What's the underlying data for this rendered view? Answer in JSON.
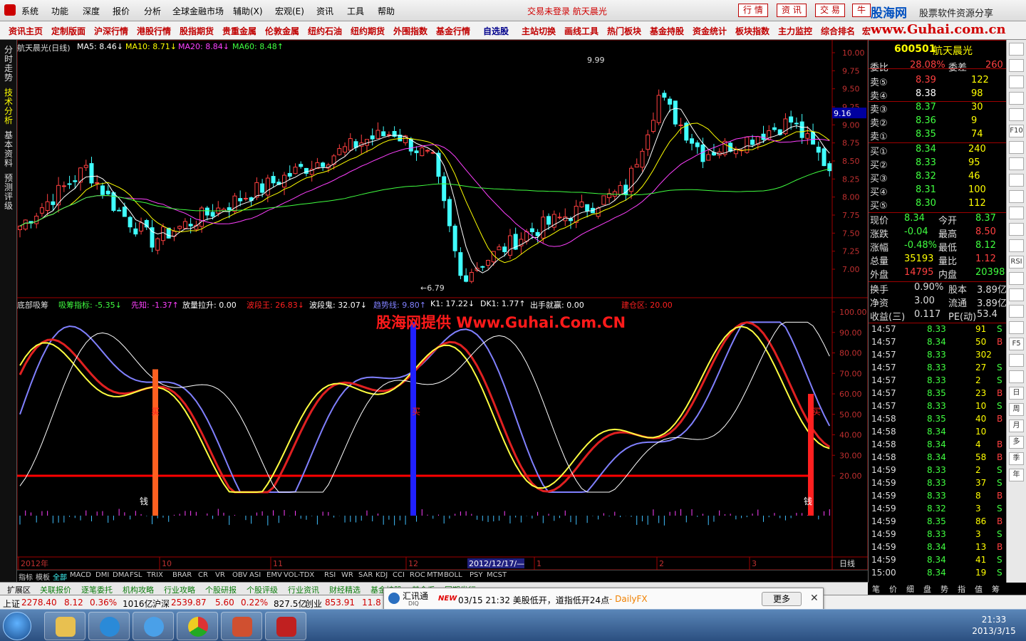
{
  "menu": {
    "items": [
      "系统",
      "功能",
      "深度",
      "报价",
      "分析",
      "全球金融市场",
      "辅助(X)",
      "宏观(E)",
      "资讯",
      "工具",
      "帮助"
    ],
    "notice": "交易未登录  航天晨光",
    "buttons": [
      "行 情",
      "资 讯",
      "交 易",
      "牛"
    ],
    "brand": "股海网",
    "brand_sub": "股票软件资源分享"
  },
  "nav": {
    "items": [
      "资讯主页",
      "定制版面",
      "沪深行情",
      "港股行情",
      "股指期货",
      "贵重金属",
      "伦敦金属",
      "纽约石油",
      "纽约期货",
      "外围指数",
      "基金行情",
      "自选股",
      "主站切换",
      "画线工具",
      "热门板块",
      "基金持股",
      "资金统计",
      "板块指数",
      "主力监控",
      "综合排名",
      "宏"
    ],
    "site": "www.Guhai.com.cn"
  },
  "left_tabs": [
    "分时走势",
    "技术分析",
    "基本资料",
    "预测评级"
  ],
  "chart": {
    "title": "航天晨光(日线)",
    "ma": [
      {
        "label": "MA5: 8.46↓",
        "color": "#ffffff"
      },
      {
        "label": "MA10: 8.71↓",
        "color": "#ffff00"
      },
      {
        "label": "MA20: 8.84↓",
        "color": "#ff40ff"
      },
      {
        "label": "MA60: 8.48↑",
        "color": "#40ff40"
      }
    ],
    "price_axis": [
      "10.00",
      "9.75",
      "9.50",
      "9.25",
      "9.00",
      "8.75",
      "8.50",
      "8.25",
      "8.00",
      "7.75",
      "7.50",
      "7.25",
      "7.00"
    ],
    "current_price_tag": "9.16",
    "high_label": "9.99",
    "low_label": "6.79",
    "indicator_title": "底部吸筹",
    "indicators": [
      {
        "label": "吸筹指标: -5.35↓",
        "color": "#40ff40"
      },
      {
        "label": "先知: -1.37↑",
        "color": "#ff40ff"
      },
      {
        "label": "放量拉升: 0.00",
        "color": "#ffffff"
      },
      {
        "label": "波段王: 26.83↓",
        "color": "#ff2020"
      },
      {
        "label": "波段鬼: 32.07↓",
        "color": "#ffffff"
      },
      {
        "label": "趋势线: 9.80↑",
        "color": "#8080ff"
      },
      {
        "label": "K1: 17.22↓",
        "color": "#ffffff"
      },
      {
        "label": "DK1: 1.77↑",
        "color": "#ffffff"
      },
      {
        "label": "出手就赢: 0.00",
        "color": "#ffffff"
      },
      {
        "label": "建仓区: 20.00",
        "color": "#ff2020"
      }
    ],
    "ind_axis": [
      "100.00",
      "90.00",
      "80.00",
      "70.00",
      "60.00",
      "50.00",
      "40.00",
      "30.00",
      "20.00"
    ],
    "watermark": "股海网提供 Www.Guhai.Com.CN",
    "buy_label": "买",
    "money_label": "钱",
    "date_axis": [
      "2012年",
      "10",
      "11",
      "12",
      "1",
      "2",
      "3"
    ],
    "date_cursor": "2012/12/17/—",
    "period": "日线",
    "bottom_tabs": [
      "指标",
      "模板",
      "全部",
      "MACD",
      "DMI",
      "DMA",
      "FSL",
      "TRIX",
      "BRAR",
      "CR",
      "VR",
      "OBV",
      "ASI",
      "EMV",
      "VOL-TDX",
      "RSI",
      "WR",
      "SAR",
      "KDJ",
      "CCI",
      "ROC",
      "MTM",
      "BOLL",
      "PSY",
      "MCST"
    ]
  },
  "ext_bar": [
    "扩展区",
    "关联报价",
    "逐笔委托",
    "机构攻略",
    "行业攻略",
    "个股研报",
    "个股评级",
    "行业资讯",
    "财经精选",
    "基金持股",
    "基金系",
    "同期发行"
  ],
  "status_bar": {
    "sh_label": "上证",
    "sh_index": "2278.40",
    "sh_change": "8.12",
    "sh_pct": "0.36%",
    "sh_amount": "1016亿",
    "sz_label": "沪深",
    "sz_index": "2539.87",
    "sz_change": "5.60",
    "sz_pct": "0.22%",
    "sz_amount": "827.5亿",
    "cy_label": "创业",
    "cy_index": "853.91",
    "cy_change": "11.8"
  },
  "news": {
    "app": "汇讯通",
    "app_sub": "DIQ",
    "tag": "NEW",
    "text": "03/15 21:32 美股低开，道指低开24点",
    "source": "- DailyFX",
    "more": "更多",
    "close": "✕"
  },
  "quote": {
    "code": "600501",
    "name": "航天晨光",
    "webi_label": "委比",
    "webi": "28.08%",
    "weicha_label": "委差",
    "weicha": "260",
    "sell": [
      {
        "label": "卖⑤",
        "price": "8.39",
        "vol": "122"
      },
      {
        "label": "卖④",
        "price": "8.38",
        "vol": "98"
      },
      {
        "label": "卖③",
        "price": "8.37",
        "vol": "30"
      },
      {
        "label": "卖②",
        "price": "8.36",
        "vol": "9"
      },
      {
        "label": "卖①",
        "price": "8.35",
        "vol": "74"
      }
    ],
    "buy": [
      {
        "label": "买①",
        "price": "8.34",
        "vol": "240"
      },
      {
        "label": "买②",
        "price": "8.33",
        "vol": "95"
      },
      {
        "label": "买③",
        "price": "8.32",
        "vol": "46"
      },
      {
        "label": "买④",
        "price": "8.31",
        "vol": "100"
      },
      {
        "label": "买⑤",
        "price": "8.30",
        "vol": "112"
      }
    ],
    "stats": [
      {
        "l1": "现价",
        "v1": "8.34",
        "c1": "#40ff40",
        "l2": "今开",
        "v2": "8.37",
        "c2": "#40ff40"
      },
      {
        "l1": "涨跌",
        "v1": "-0.04",
        "c1": "#40ff40",
        "l2": "最高",
        "v2": "8.50",
        "c2": "#ff4040"
      },
      {
        "l1": "涨幅",
        "v1": "-0.48%",
        "c1": "#40ff40",
        "l2": "最低",
        "v2": "8.12",
        "c2": "#40ff40"
      },
      {
        "l1": "总量",
        "v1": "35193",
        "c1": "#ffff00",
        "l2": "量比",
        "v2": "1.12",
        "c2": "#ff4040"
      },
      {
        "l1": "外盘",
        "v1": "14795",
        "c1": "#ff4040",
        "l2": "内盘",
        "v2": "20398",
        "c2": "#40ff40"
      }
    ],
    "fund": [
      {
        "l1": "换手",
        "v1": "0.90%",
        "l2": "股本",
        "v2": "3.89亿"
      },
      {
        "l1": "净资",
        "v1": "3.00",
        "l2": "流通",
        "v2": "3.89亿"
      },
      {
        "l1": "收益(三)",
        "v1": "0.117",
        "l2": "PE(动)",
        "v2": "53.4"
      }
    ]
  },
  "ticks": [
    {
      "t": "14:57",
      "p": "8.33",
      "v": "91",
      "s": "S"
    },
    {
      "t": "14:57",
      "p": "8.34",
      "v": "50",
      "s": "B"
    },
    {
      "t": "14:57",
      "p": "8.33",
      "v": "302",
      "s": ""
    },
    {
      "t": "14:57",
      "p": "8.33",
      "v": "27",
      "s": "S"
    },
    {
      "t": "14:57",
      "p": "8.33",
      "v": "2",
      "s": "S"
    },
    {
      "t": "14:57",
      "p": "8.35",
      "v": "23",
      "s": "B"
    },
    {
      "t": "14:57",
      "p": "8.33",
      "v": "10",
      "s": "S"
    },
    {
      "t": "14:58",
      "p": "8.35",
      "v": "40",
      "s": "B"
    },
    {
      "t": "14:58",
      "p": "8.34",
      "v": "10",
      "s": ""
    },
    {
      "t": "14:58",
      "p": "8.34",
      "v": "4",
      "s": "B"
    },
    {
      "t": "14:58",
      "p": "8.34",
      "v": "58",
      "s": "B"
    },
    {
      "t": "14:59",
      "p": "8.33",
      "v": "2",
      "s": "S"
    },
    {
      "t": "14:59",
      "p": "8.33",
      "v": "37",
      "s": "S"
    },
    {
      "t": "14:59",
      "p": "8.33",
      "v": "8",
      "s": "B"
    },
    {
      "t": "14:59",
      "p": "8.32",
      "v": "3",
      "s": "S"
    },
    {
      "t": "14:59",
      "p": "8.35",
      "v": "86",
      "s": "B"
    },
    {
      "t": "14:59",
      "p": "8.33",
      "v": "3",
      "s": "S"
    },
    {
      "t": "14:59",
      "p": "8.34",
      "v": "13",
      "s": "B"
    },
    {
      "t": "14:59",
      "p": "8.34",
      "v": "41",
      "s": "S"
    },
    {
      "t": "15:00",
      "p": "8.34",
      "v": "19",
      "s": "S"
    }
  ],
  "bottom_right_tabs": [
    "笔",
    "价",
    "细",
    "盘",
    "势",
    "指",
    "值",
    "筹"
  ],
  "right_tools": [
    "",
    "",
    "",
    "",
    "",
    "F10",
    "",
    "",
    "",
    "",
    "",
    "",
    "",
    "RSI",
    "",
    "",
    "",
    "",
    "F5",
    "",
    "",
    "日",
    "周",
    "月",
    "多",
    "季",
    "年"
  ],
  "clock": {
    "time": "21:33",
    "date": "2013/3/15"
  },
  "colors": {
    "up": "#ff4040",
    "down": "#40ffff",
    "ma5": "#ffffff",
    "ma10": "#ffff00",
    "ma20": "#ff40ff",
    "ma60": "#40ff40",
    "grid": "#800000"
  }
}
